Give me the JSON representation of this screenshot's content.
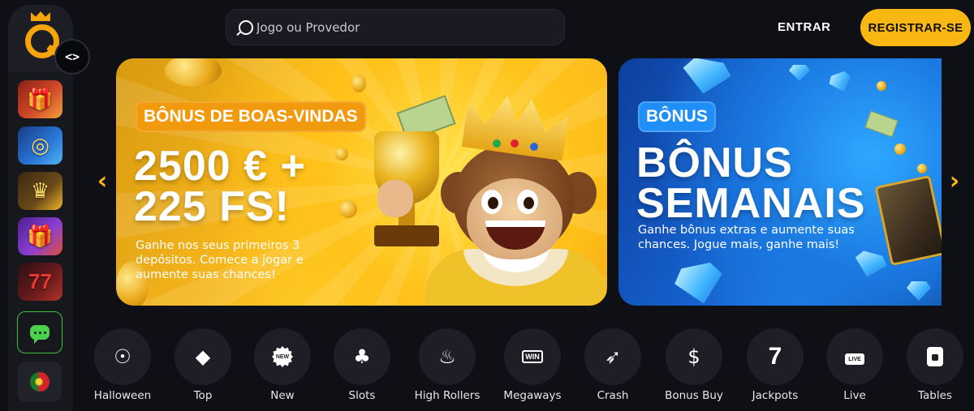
{
  "header": {
    "search_placeholder": "Jogo ou Provedor",
    "login_label": "ENTRAR",
    "register_label": "REGISTRAR-SE"
  },
  "colors": {
    "accent": "#f8b712",
    "background": "#0f1015",
    "chat_green": "#4cd14c",
    "welcome_badge": "#f29a0e",
    "bonus_badge": "#1f8ef7"
  },
  "sidebar": {
    "toggle_icon": "<>",
    "tiles": [
      "gift-promo-icon",
      "target-icon",
      "crown-icon",
      "gift-box-icon",
      "lucky-seven-icon"
    ],
    "chat_icon": "chat-icon",
    "language_icon": "portugal-flag-icon"
  },
  "carousel": {
    "prev_icon": "chevron-left-icon",
    "next_icon": "chevron-right-icon",
    "banners": [
      {
        "badge": "BÔNUS DE BOAS-VINDAS",
        "headline_line1": "2500 € +",
        "headline_line2": "225 FS!",
        "description": "Ganhe nos seus primeiros 3 depósitos. Comece a jogar e aumente suas chances!"
      },
      {
        "badge": "BÔNUS",
        "headline_line1": "BÔNUS",
        "headline_line2": "SEMANAIS",
        "description": "Ganhe bônus extras e aumente suas chances. Jogue mais, ganhe mais!"
      }
    ]
  },
  "categories": [
    {
      "label": "Halloween",
      "icon": "pumpkin-icon"
    },
    {
      "label": "Top",
      "icon": "diamond-icon"
    },
    {
      "label": "New",
      "icon": "new-badge-icon",
      "icon_text": "NEW"
    },
    {
      "label": "Slots",
      "icon": "cherries-icon"
    },
    {
      "label": "High Rollers",
      "icon": "flame-icon"
    },
    {
      "label": "Megaways",
      "icon": "megaways-icon",
      "icon_text": "WIN"
    },
    {
      "label": "Crash",
      "icon": "rocket-icon"
    },
    {
      "label": "Bonus Buy",
      "icon": "money-bag-icon"
    },
    {
      "label": "Jackpots",
      "icon": "seven-icon",
      "icon_text": "7"
    },
    {
      "label": "Live",
      "icon": "live-icon",
      "icon_text": "LIVE"
    },
    {
      "label": "Tables",
      "icon": "cards-icon"
    }
  ]
}
